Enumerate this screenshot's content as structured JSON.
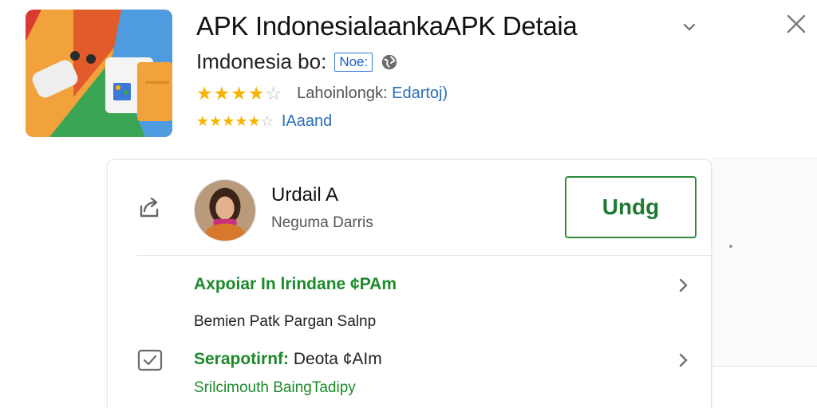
{
  "header": {
    "app_title": "APK IndonesialaankaAPK Detaia",
    "developer": "Imdonesia bo:",
    "developer_badge": "Noe:",
    "rating_primary": {
      "stars": 4,
      "label": "Lahoinlongk:",
      "link": "Edartoj)"
    },
    "rating_secondary": {
      "stars": 4.5,
      "link": "IAaand"
    }
  },
  "profile": {
    "name": "Urdail A",
    "subtitle": "Neguma Darris",
    "action_label": "Undg"
  },
  "rows": [
    {
      "title": "Axpoiar In lrindane ¢PAm",
      "line": "Bemien Patk Pargan Salnp"
    },
    {
      "title": "Serapotirnf:",
      "title_suffix": "Deota ¢AIm",
      "line": "Srilcimouth BaingTadipy"
    }
  ],
  "colors": {
    "accent_green": "#1b8a2a",
    "button_border": "#2e8b3e",
    "star": "#f5b400",
    "link_blue": "#2a6fb5"
  },
  "icons": {
    "close": "close-icon",
    "chevron": "chevron-down-icon",
    "share": "share-icon",
    "globe": "globe-icon",
    "check": "checkbox-icon"
  }
}
